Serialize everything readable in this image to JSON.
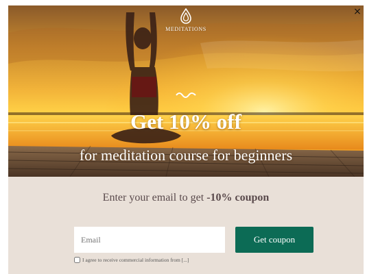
{
  "brand": {
    "logo_icon": "lotus-drop-icon",
    "name": "MEDITATIONS"
  },
  "close": {
    "icon": "close-icon",
    "glyph": "×"
  },
  "hero": {
    "decoration_icon": "wave-icon",
    "headline": "Get 10% off",
    "subheadline": "for meditation course for beginners"
  },
  "form": {
    "prompt_text": "Enter your email to get ",
    "prompt_bold": "-10% coupon",
    "email_placeholder": "Email",
    "email_value": "",
    "submit_label": "Get coupon",
    "consent_label": "I agree to receive commercial information from [...]",
    "consent_checked": false
  },
  "colors": {
    "accent": "#0c6b55",
    "form_background": "#e9e0d8",
    "prompt_text": "#5a4a4c"
  }
}
